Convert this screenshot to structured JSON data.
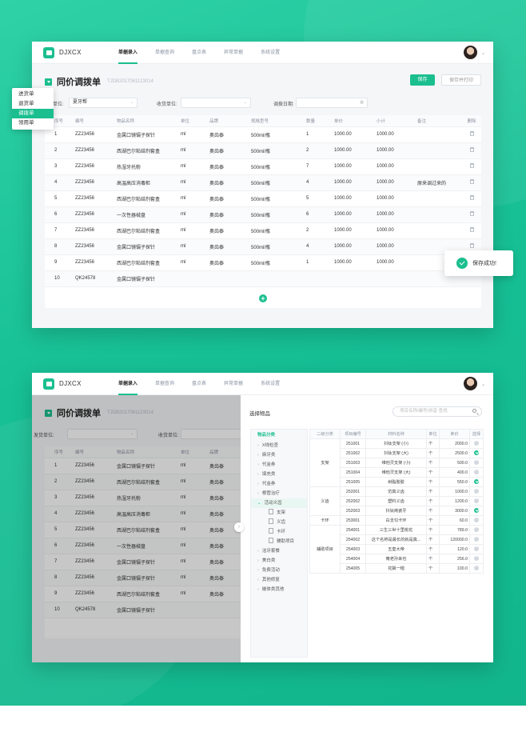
{
  "app": {
    "brand": "DJXCX",
    "nav": [
      "单据录入",
      "单据查询",
      "盘点表",
      "异常单据",
      "系统设置"
    ]
  },
  "screen1": {
    "title": "同价调拨单",
    "doc_no": "TJDB2017061123014",
    "save": "保存",
    "save_print": "保存并打印",
    "dropdown": [
      "进货单",
      "退货单",
      "调拨单",
      "领用单"
    ],
    "dropdown_selected": 2,
    "f1_label": "单位:",
    "f1_value": "夏牙帮",
    "f2_label": "收货单位:",
    "f3_label": "调拨日期:",
    "toast": "保存成功!",
    "columns": [
      "序号",
      "编号",
      "物品名称",
      "单位",
      "品牌",
      "规格型号",
      "数量",
      "单价",
      "小计",
      "备注",
      "删除"
    ],
    "rows": [
      [
        "1",
        "ZZ23456",
        "金属口镜镊子探针",
        "ml",
        "奥齿泰",
        "500ml/瓶",
        "1",
        "1000.00",
        "1000.00",
        ""
      ],
      [
        "2",
        "ZZ23456",
        "西湖巴尔粘结剂套盒",
        "ml",
        "奥齿泰",
        "500ml/瓶",
        "2",
        "1000.00",
        "1000.00",
        ""
      ],
      [
        "3",
        "ZZ23456",
        "热湿牙托粉",
        "ml",
        "奥齿泰",
        "500ml/瓶",
        "7",
        "1000.00",
        "1000.00",
        ""
      ],
      [
        "4",
        "ZZ23456",
        "高温高压消毒柜",
        "ml",
        "奥齿泰",
        "500ml/瓶",
        "4",
        "1000.00",
        "1000.00",
        "原来调过来的"
      ],
      [
        "5",
        "ZZ23456",
        "西湖巴尔粘结剂套盒",
        "ml",
        "奥齿泰",
        "500ml/瓶",
        "5",
        "1000.00",
        "1000.00",
        ""
      ],
      [
        "6",
        "ZZ23456",
        "一次性器械盘",
        "ml",
        "奥齿泰",
        "500ml/瓶",
        "6",
        "1000.00",
        "1000.00",
        ""
      ],
      [
        "7",
        "ZZ23456",
        "西湖巴尔粘结剂套盒",
        "ml",
        "奥齿泰",
        "500ml/瓶",
        "2",
        "1000.00",
        "1000.00",
        ""
      ],
      [
        "8",
        "ZZ23456",
        "金属口镜镊子探针",
        "ml",
        "奥齿泰",
        "500ml/瓶",
        "4",
        "1000.00",
        "1000.00",
        ""
      ],
      [
        "9",
        "ZZ23456",
        "西湖巴尔粘结剂套盒",
        "ml",
        "奥齿泰",
        "500ml/瓶",
        "1",
        "1000.00",
        "1000.00",
        ""
      ],
      [
        "10",
        "QK24578",
        "金属口镜镊子探针",
        "",
        "",
        "",
        "",
        "",
        "",
        ""
      ]
    ]
  },
  "screen2": {
    "title": "同价调拨单",
    "doc_no": "TJDB2017061123014",
    "f1_label": "发货单位:",
    "f2_label": "收货单位:",
    "columns": [
      "序号",
      "编号",
      "物品名称",
      "单位",
      "品牌"
    ],
    "rows": [
      [
        "1",
        "ZZ23456",
        "金属口镜镊子探针",
        "ml",
        "奥齿泰"
      ],
      [
        "2",
        "ZZ23456",
        "西湖巴尔粘结剂套盒",
        "ml",
        "奥齿泰"
      ],
      [
        "3",
        "ZZ23456",
        "热湿牙托粉",
        "ml",
        "奥齿泰"
      ],
      [
        "4",
        "ZZ23456",
        "高温高压消毒柜",
        "ml",
        "奥齿泰"
      ],
      [
        "5",
        "ZZ23456",
        "西湖巴尔粘结剂套盒",
        "ml",
        "奥齿泰"
      ],
      [
        "6",
        "ZZ23456",
        "一次性器械盘",
        "ml",
        "奥齿泰"
      ],
      [
        "7",
        "ZZ23456",
        "金属口镜镊子探针",
        "ml",
        "奥齿泰"
      ],
      [
        "8",
        "ZZ23456",
        "金属口镜镊子探针",
        "ml",
        "奥齿泰"
      ],
      [
        "9",
        "ZZ23456",
        "西湖巴尔粘结剂套盒",
        "ml",
        "奥齿泰"
      ],
      [
        "10",
        "QK24578",
        "金属口镜镊子探针",
        "",
        ""
      ]
    ],
    "panel": {
      "title": "选择物品",
      "search_placeholder": "项目名称/编号/拼音 查找",
      "tree_header": "物品分类",
      "tree": [
        {
          "label": "X线检查",
          "type": "c"
        },
        {
          "label": "麻牙类",
          "type": "c"
        },
        {
          "label": "代金券",
          "type": "c"
        },
        {
          "label": "填充类",
          "type": "c"
        },
        {
          "label": "代金券",
          "type": "c"
        },
        {
          "label": "根管治疗",
          "type": "c"
        },
        {
          "label": "活动义齿",
          "type": "open"
        },
        {
          "label": "支架",
          "type": "leaf"
        },
        {
          "label": "义齿",
          "type": "leaf"
        },
        {
          "label": "卡环",
          "type": "leaf"
        },
        {
          "label": "辅助项目",
          "type": "leaf"
        },
        {
          "label": "洁牙套餐",
          "type": "c"
        },
        {
          "label": "美白类",
          "type": "c"
        },
        {
          "label": "免费活动",
          "type": "c"
        },
        {
          "label": "其他修复",
          "type": "c"
        },
        {
          "label": "嵌体类其他",
          "type": "c"
        }
      ],
      "columns": [
        "二级分类",
        "项目编号",
        "材料名称",
        "单位",
        "单价",
        "选择"
      ],
      "groups": [
        {
          "name": "支架",
          "rows": [
            [
              "251001",
              "抖钛支架 (小)",
              "个",
              "2000.0",
              "off"
            ],
            [
              "251002",
              "抖钛支架 (大)",
              "个",
              "2500.0",
              "on"
            ],
            [
              "251003",
              "维他灵支架 (小)",
              "个",
              "500.0",
              "off"
            ],
            [
              "251004",
              "维他灵支架 (大)",
              "个",
              "400.0",
              "off"
            ],
            [
              "251005",
              "树脂胶胶",
              "个",
              "550.0",
              "on"
            ]
          ]
        },
        {
          "name": "义齿",
          "rows": [
            [
              "252001",
              "仿真义齿",
              "个",
              "1000.0",
              "off"
            ],
            [
              "252002",
              "塑料义齿",
              "个",
              "1200.0",
              "off"
            ],
            [
              "252003",
              "抖钛烤瓷牙",
              "个",
              "3000.0",
              "on"
            ]
          ]
        },
        {
          "name": "卡环",
          "rows": [
            [
              "253001",
              "白支勾卡环",
              "个",
              "60.0",
              "off"
            ]
          ]
        },
        {
          "name": "辅助项目",
          "rows": [
            [
              "254001",
              "三生三世十里桃花",
              "个",
              "789.0",
              "off"
            ],
            [
              "254002",
              "这个名称是最长的就是真...",
              "个",
              "120000.0",
              "off"
            ],
            [
              "254003",
              "玉皇大帝",
              "个",
              "120.0",
              "off"
            ],
            [
              "254004",
              "俺老孙来也",
              "个",
              "256.0",
              "off"
            ],
            [
              "254005",
              "花飘一帽",
              "个",
              "100.0",
              "off"
            ]
          ]
        }
      ]
    }
  }
}
